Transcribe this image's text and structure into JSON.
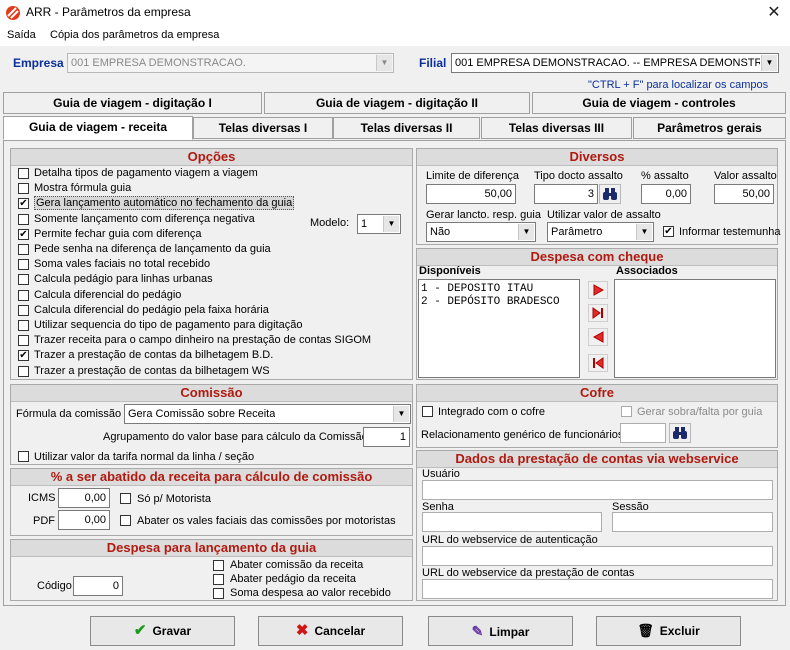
{
  "window": {
    "title": "ARR - Parâmetros da empresa"
  },
  "menu": {
    "items": [
      "Saída",
      "Cópia dos parâmetros da empresa"
    ]
  },
  "top": {
    "empresa_label": "Empresa",
    "empresa_value": "001 EMPRESA DEMONSTRACAO.",
    "filial_label": "Filial",
    "filial_value": "001 EMPRESA DEMONSTRACAO. -- EMPRESA DEMONSTRA",
    "hint": "\"CTRL + F\" para localizar os campos"
  },
  "tabs": {
    "row1": [
      "Guia de viagem - digitação I",
      "Guia de viagem - digitação II",
      "Guia de viagem - controles"
    ],
    "row2": [
      "Guia de viagem - receita",
      "Telas diversas I",
      "Telas diversas II",
      "Telas diversas III",
      "Parâmetros gerais"
    ]
  },
  "opcoes": {
    "title": "Opções",
    "items": [
      {
        "label": "Detalha tipos de pagamento viagem a viagem",
        "checked": false
      },
      {
        "label": "Mostra fórmula guia",
        "checked": false
      },
      {
        "label": "Gera lançamento automático no fechamento da guia",
        "checked": true
      },
      {
        "label": "Somente lançamento com diferença negativa",
        "checked": false
      },
      {
        "label": "Permite fechar guia com diferença",
        "checked": true
      },
      {
        "label": "Pede senha na diferença de lançamento da guia",
        "checked": false
      },
      {
        "label": "Soma vales faciais no total recebido",
        "checked": false
      },
      {
        "label": "Calcula pedágio para linhas urbanas",
        "checked": false
      },
      {
        "label": "Calcula diferencial do pedágio",
        "checked": false
      },
      {
        "label": "Calcula diferencial do pedágio pela faixa horária",
        "checked": false
      },
      {
        "label": "Utilizar sequencia do tipo de pagamento para digitação",
        "checked": false
      },
      {
        "label": "Trazer receita para o campo dinheiro na prestação de contas SIGOM",
        "checked": false
      },
      {
        "label": "Trazer a prestação de contas da bilhetagem B.D.",
        "checked": true
      },
      {
        "label": "Trazer a prestação de contas da bilhetagem WS",
        "checked": false
      }
    ],
    "modelo_label": "Modelo:",
    "modelo_value": "1"
  },
  "diversos": {
    "title": "Diversos",
    "limite_label": "Limite de diferença",
    "limite_value": "50,00",
    "tipo_label": "Tipo docto assalto",
    "tipo_value": "3",
    "pct_label": "% assalto",
    "pct_value": "0,00",
    "valor_label": "Valor assalto",
    "valor_value": "50,00",
    "gerar_label": "Gerar lancto. resp. guia",
    "gerar_value": "Não",
    "utilizar_label": "Utilizar valor de assalto",
    "utilizar_value": "Parâmetro",
    "informar_label": "Informar testemunha"
  },
  "cheque": {
    "title": "Despesa com cheque",
    "disp_label": "Disponíveis",
    "assoc_label": "Associados",
    "items": [
      "1 - DEPOSITO ITAU",
      "2 - DEPÓSITO BRADESCO"
    ]
  },
  "comissao": {
    "title": "Comissão",
    "formula_label": "Fórmula da comissão",
    "formula_value": "Gera Comissão sobre  Receita",
    "agrup_label": "Agrupamento do valor base para cálculo da Comissão",
    "agrup_value": "1",
    "tarifa_label": "Utilizar valor da tarifa normal da linha / seção"
  },
  "abatido": {
    "title": "% a ser abatido da receita para cálculo de comissão",
    "icms_label": "ICMS",
    "icms_value": "0,00",
    "pdf_label": "PDF",
    "pdf_value": "0,00",
    "so_label": "Só p/ Motorista",
    "abater_label": "Abater os vales faciais das comissões por motoristas"
  },
  "despesa": {
    "title": "Despesa para lançamento da guia",
    "codigo_label": "Código",
    "codigo_value": "0",
    "items": [
      "Abater comissão da receita",
      "Abater pedágio da receita",
      "Soma despesa ao valor recebido"
    ]
  },
  "cofre": {
    "title": "Cofre",
    "integrado_label": "Integrado com o cofre",
    "gerar_label": "Gerar sobra/falta por guia",
    "relac_label": "Relacionamento genérico de funcionários"
  },
  "ws": {
    "title": "Dados da prestação de contas via webservice",
    "usuario_label": "Usuário",
    "senha_label": "Senha",
    "sessao_label": "Sessão",
    "url_auth_label": "URL do webservice de autenticação",
    "url_prest_label": "URL do webservice da prestação de contas"
  },
  "buttons": {
    "gravar": "Gravar",
    "cancelar": "Cancelar",
    "limpar": "Limpar",
    "excluir": "Excluir"
  }
}
